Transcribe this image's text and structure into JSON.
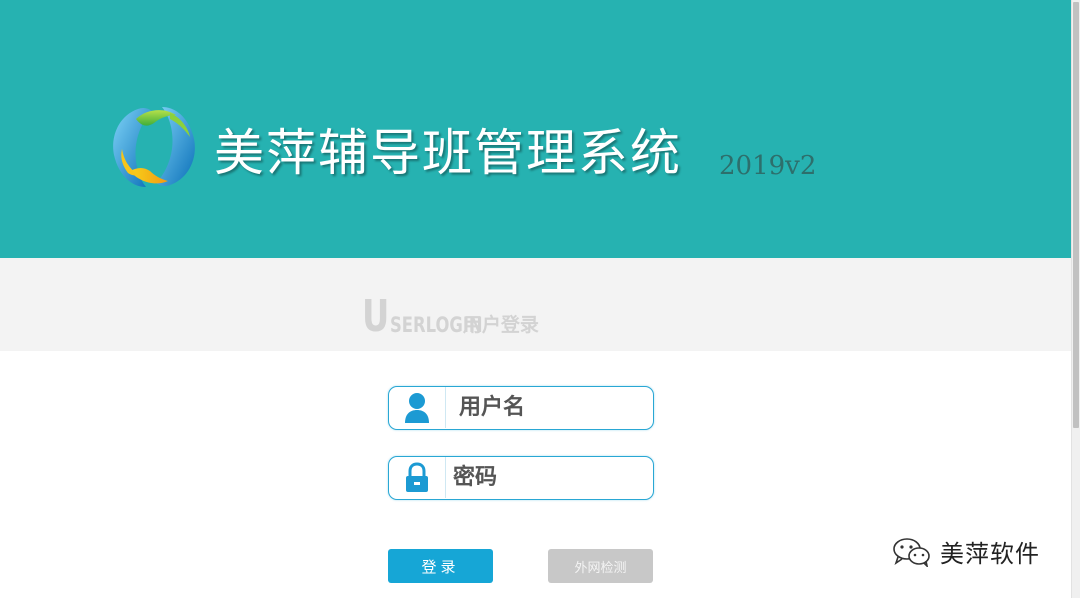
{
  "header": {
    "app_title": "美萍辅导班管理系统",
    "version": "2019v2",
    "background_color": "#26b2b1"
  },
  "banner": {
    "heading_en_first": "U",
    "heading_en_rest": "SERLOGIN",
    "heading_cn": "用户登录"
  },
  "form": {
    "username": {
      "placeholder": "用户名",
      "icon": "user-icon"
    },
    "password": {
      "placeholder": "密码",
      "icon": "lock-icon"
    },
    "login_label": "登录",
    "netcheck_label": "外网检测",
    "accent_color": "#16a6d6"
  },
  "watermark": {
    "text": "美萍软件",
    "icon": "wechat-icon"
  }
}
